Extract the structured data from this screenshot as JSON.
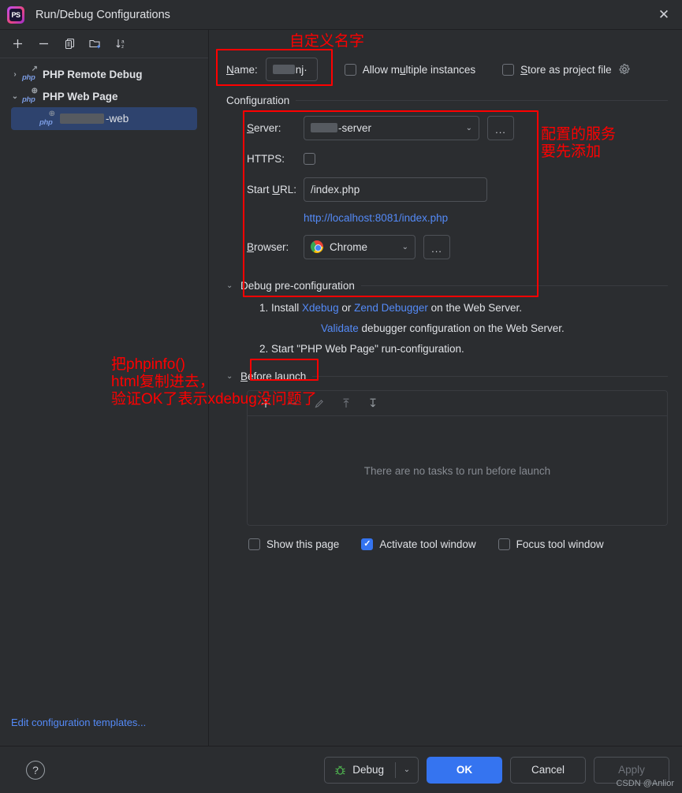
{
  "window": {
    "title": "Run/Debug Configurations",
    "app_icon": "phpstorm-logo",
    "logo_text": "PS",
    "close_label": "✕"
  },
  "left_panel": {
    "toolbar": [
      {
        "name": "add-configuration-button",
        "glyph": "+"
      },
      {
        "name": "remove-configuration-button",
        "glyph": "−"
      },
      {
        "name": "copy-configuration-button",
        "glyph": "copy-icon"
      },
      {
        "name": "new-folder-button",
        "glyph": "folder-add-icon"
      },
      {
        "name": "sort-configurations-button",
        "glyph": "sort-az-icon"
      }
    ],
    "tree": [
      {
        "label": "PHP Remote Debug",
        "expanded": false,
        "twisty": "›",
        "icon": "php-remote-icon",
        "selected": false
      },
      {
        "label": "PHP Web Page",
        "expanded": true,
        "twisty": "⌄",
        "icon": "php-web-icon",
        "selected": false
      }
    ],
    "selected_item": {
      "label": "-web",
      "redacted": true,
      "icon": "php-web-icon"
    },
    "edit_templates_link": "Edit configuration templates..."
  },
  "name_row": {
    "label": "Name:",
    "label_mnemonic": "N",
    "value": "nj·",
    "value_redacted": true,
    "allow_multiple_instances": {
      "label": "Allow multiple instances",
      "mnemonic": "u",
      "checked": false
    },
    "store_as_project_file": {
      "label": "Store as project file",
      "mnemonic": "S",
      "checked": false,
      "gear_icon": "gear-icon"
    }
  },
  "configuration": {
    "section_title": "Configuration",
    "server": {
      "label": "Server:",
      "mnemonic": "S",
      "value": "-server",
      "value_redacted": true,
      "ellipsis_button": "...",
      "caret": "⌄"
    },
    "https": {
      "label": "HTTPS:",
      "checked": false
    },
    "start_url": {
      "label": "Start URL:",
      "mnemonic": "U",
      "value": "/index.php"
    },
    "url_preview": "http://localhost:8081/index.php",
    "browser": {
      "label": "Browser:",
      "mnemonic": "B",
      "value": "Chrome",
      "icon": "chrome-icon",
      "ellipsis_button": "...",
      "caret": "⌄"
    }
  },
  "debug_preconfig": {
    "section_title": "Debug pre-configuration",
    "caret": "⌄",
    "line1_prefix": "1. Install ",
    "line1_link1": "Xdebug",
    "line1_mid": " or ",
    "line1_link2": "Zend Debugger",
    "line1_suffix": " on the Web Server.",
    "line2_link": "Validate",
    "line2_suffix": " debugger configuration on the Web Server.",
    "line3": "2. Start \"PHP Web Page\" run-configuration."
  },
  "before_launch": {
    "section_title": "Before launch",
    "mnemonic": "B",
    "caret": "⌄",
    "toolbar": [
      {
        "name": "add-task-button",
        "glyph": "+"
      },
      {
        "name": "remove-task-button",
        "glyph": "−"
      },
      {
        "name": "edit-task-button",
        "glyph": "pencil-icon"
      },
      {
        "name": "move-task-up-button",
        "glyph": "arrow-up-icon"
      },
      {
        "name": "move-task-down-button",
        "glyph": "arrow-down-icon"
      }
    ],
    "empty_message": "There are no tasks to run before launch",
    "checkboxes": [
      {
        "label": "Show this page",
        "checked": false,
        "name": "show-this-page"
      },
      {
        "label": "Activate tool window",
        "checked": true,
        "name": "activate-tool-window"
      },
      {
        "label": "Focus tool window",
        "checked": false,
        "name": "focus-tool-window"
      }
    ]
  },
  "bottom_bar": {
    "help": "?",
    "debug_button": {
      "label": "Debug",
      "icon": "bug-icon",
      "caret": "⌄"
    },
    "ok_button": "OK",
    "cancel_button": "Cancel",
    "apply_button": "Apply"
  },
  "annotations": [
    {
      "name": "annotation-custom-name",
      "text": "自定义名字"
    },
    {
      "name": "annotation-server-config",
      "text": "配置的服务\n要先添加"
    },
    {
      "name": "annotation-phpinfo",
      "text": "把phpinfo()\nhtml复制进去，\n验证OK了表示xdebug没问题了"
    }
  ],
  "watermark": "CSDN @Anlior",
  "colors": {
    "background": "#2b2d30",
    "accent": "#3574f0",
    "link": "#548af7",
    "selection": "#2e436e",
    "annotation": "#ff0000"
  }
}
